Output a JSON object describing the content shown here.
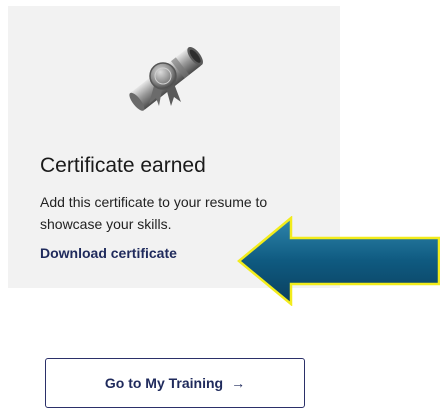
{
  "card": {
    "icon": "certificate-scroll-icon",
    "title": "Certificate earned",
    "description": "Add this certificate to your resume to showcase your skills.",
    "download_link_label": "Download certificate"
  },
  "annotation": {
    "icon": "pointer-arrow-icon",
    "fill_color": "#0f5a80",
    "outline_color": "#f2ec1c"
  },
  "actions": {
    "training_button_label": "Go to My Training",
    "training_button_icon": "arrow-right-icon",
    "training_button_glyph": "→"
  },
  "colors": {
    "card_background": "#f2f2f2",
    "link_color": "#1f2a5c",
    "button_border": "#2b3069"
  }
}
